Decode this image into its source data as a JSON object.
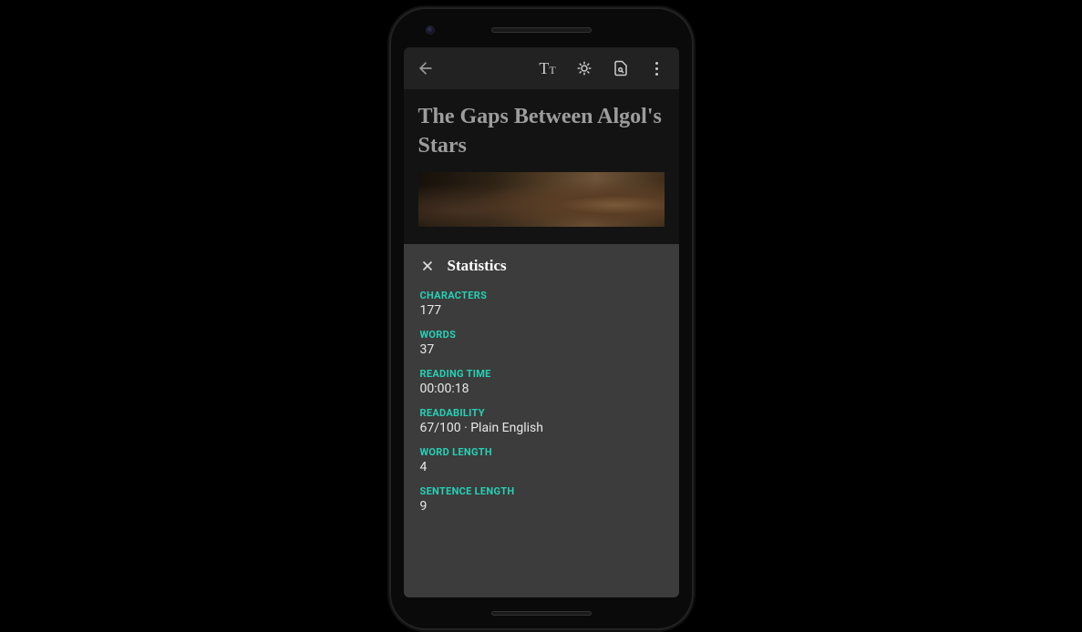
{
  "document": {
    "title": "The Gaps Between Algol's Stars"
  },
  "sheet": {
    "title": "Statistics",
    "stats": {
      "characters": {
        "label": "CHARACTERS",
        "value": "177"
      },
      "words": {
        "label": "WORDS",
        "value": "37"
      },
      "reading_time": {
        "label": "READING TIME",
        "value": "00:00:18"
      },
      "readability": {
        "label": "READABILITY",
        "value": "67/100 · Plain English"
      },
      "word_length": {
        "label": "WORD LENGTH",
        "value": "4"
      },
      "sentence_length": {
        "label": "SENTENCE LENGTH",
        "value": "9"
      }
    }
  }
}
